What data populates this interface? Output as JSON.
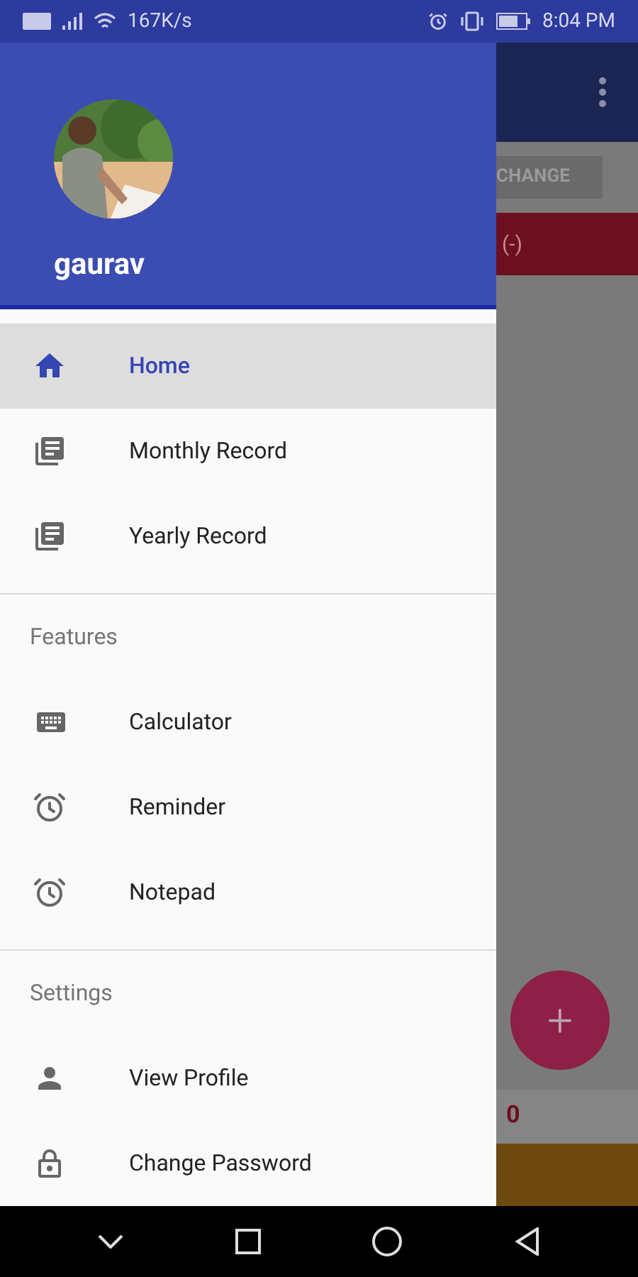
{
  "status_bar": {
    "network_speed": "167K/s",
    "time": "8:04 PM"
  },
  "background_screen": {
    "button": "CHANGE",
    "banner_text": "(-)",
    "fab_label": "+",
    "total_value": "0"
  },
  "drawer": {
    "user_name": "gaurav",
    "sections": [
      {
        "items": [
          {
            "label": "Home",
            "kind": "home",
            "selected": true
          },
          {
            "label": "Monthly Record",
            "kind": "records",
            "selected": false
          },
          {
            "label": "Yearly Record",
            "kind": "records",
            "selected": false
          }
        ]
      },
      {
        "title": "Features",
        "items": [
          {
            "label": "Calculator",
            "kind": "keyboard",
            "selected": false
          },
          {
            "label": "Reminder",
            "kind": "alarm",
            "selected": false
          },
          {
            "label": "Notepad",
            "kind": "alarm",
            "selected": false
          }
        ]
      },
      {
        "title": "Settings",
        "items": [
          {
            "label": "View Profile",
            "kind": "person",
            "selected": false
          },
          {
            "label": "Change Password",
            "kind": "lock",
            "selected": false
          }
        ]
      }
    ]
  }
}
